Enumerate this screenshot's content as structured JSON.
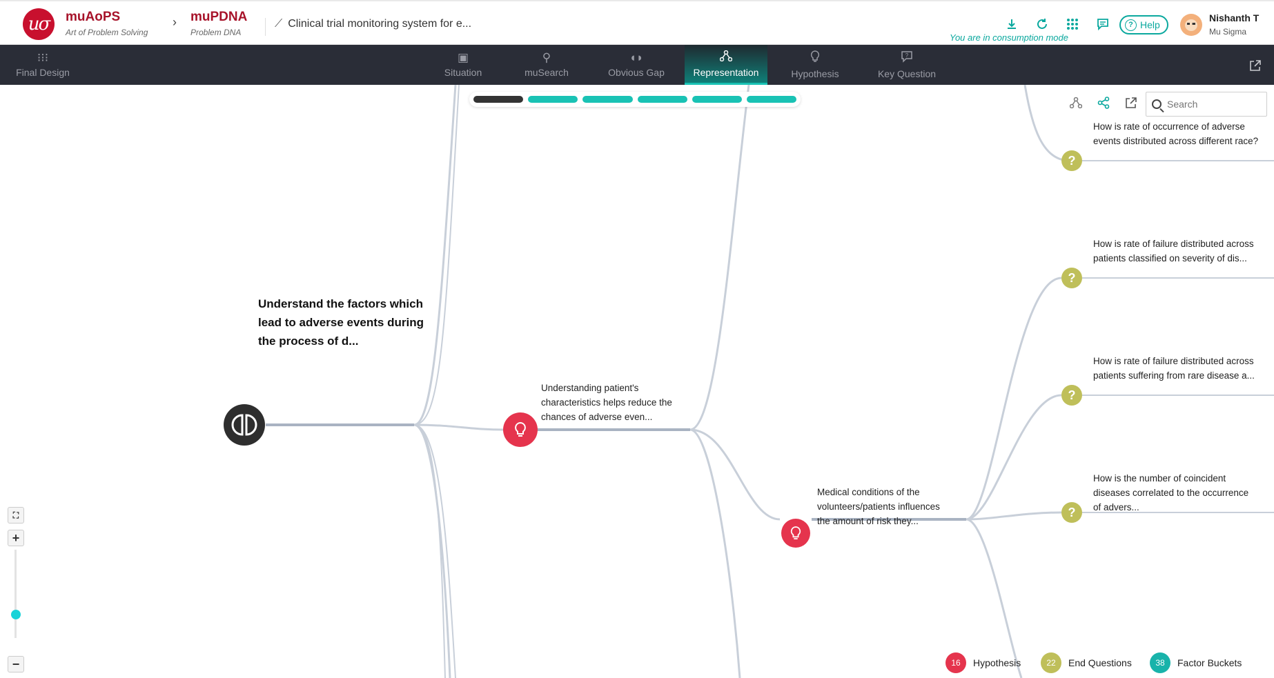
{
  "header": {
    "logo_text": "uσ",
    "app_name": "muAoPS",
    "app_sub": "Art of Problem Solving",
    "module_name": "muPDNA",
    "module_sub": "Problem DNA",
    "breadcrumb_sep": "›",
    "pdna_title": "Clinical trial monitoring system for e...",
    "mode_text": "You are in consumption mode",
    "help_label": "Help",
    "user_name": "Nishanth T",
    "user_org": "Mu Sigma"
  },
  "nav": {
    "final_design": "Final Design",
    "tabs": [
      "Situation",
      "muSearch",
      "Obvious Gap",
      "Representation",
      "Hypothesis",
      "Key Question"
    ],
    "active_tab": "Representation"
  },
  "toolbar": {
    "search_placeholder": "Search"
  },
  "tree": {
    "root": "Understand the factors which lead to adverse events during the process of d...",
    "hypothesis_1": "Understanding patient's characteristics helps reduce the chances of adverse even...",
    "hypothesis_2": "Medical conditions of the volunteers/patients influences the amount of risk they...",
    "questions": [
      "How is rate of occurrence of adverse events distributed across different race?",
      "How is rate of failure distributed across patients classified on severity of dis...",
      "How is rate of failure distributed across patients suffering from rare disease a...",
      "How is the number of coincident diseases correlated to the occurrence of advers..."
    ]
  },
  "legend": {
    "hypothesis_count": "16",
    "hypothesis_label": "Hypothesis",
    "end_questions_count": "22",
    "end_questions_label": "End Questions",
    "factor_buckets_count": "38",
    "factor_buckets_label": "Factor Buckets"
  },
  "colors": {
    "brand": "#a7132a",
    "accent": "#0aa89e",
    "hypothesis": "#e5344d",
    "question": "#bfbf5a",
    "factor": "#19b3aa",
    "navbar": "#2a2d37"
  }
}
